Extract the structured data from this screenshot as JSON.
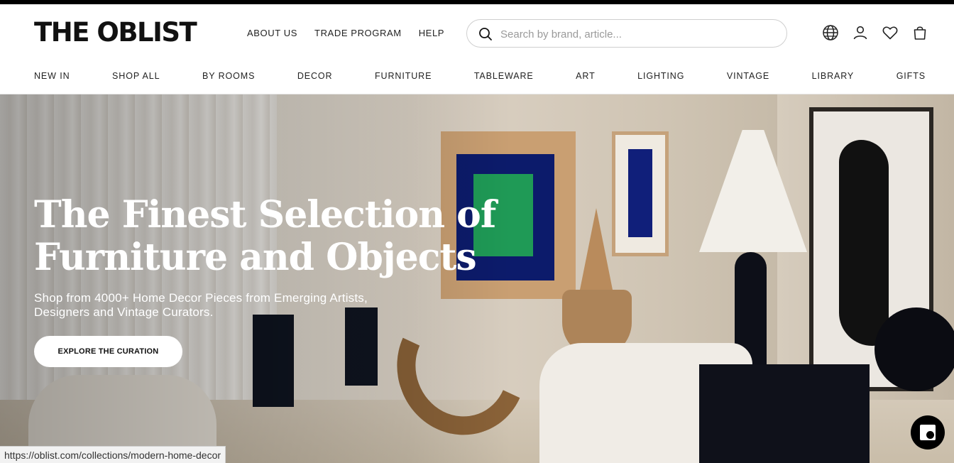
{
  "brand": {
    "logo_text": "THE OBLIST"
  },
  "utility_nav": [
    {
      "label": "ABOUT US"
    },
    {
      "label": "TRADE PROGRAM"
    },
    {
      "label": "HELP"
    }
  ],
  "search": {
    "placeholder": "Search by brand, article...",
    "value": "",
    "icon": "search-icon"
  },
  "header_icons": [
    {
      "name": "globe-icon"
    },
    {
      "name": "account-icon"
    },
    {
      "name": "wishlist-heart-icon"
    },
    {
      "name": "shopping-bag-icon"
    }
  ],
  "category_nav": [
    {
      "label": "NEW IN"
    },
    {
      "label": "SHOP ALL"
    },
    {
      "label": "BY ROOMS"
    },
    {
      "label": "DECOR"
    },
    {
      "label": "FURNITURE"
    },
    {
      "label": "TABLEWARE"
    },
    {
      "label": "ART"
    },
    {
      "label": "LIGHTING"
    },
    {
      "label": "VINTAGE"
    },
    {
      "label": "LIBRARY"
    },
    {
      "label": "GIFTS"
    }
  ],
  "hero": {
    "title_line1": "The Finest Selection of",
    "title_line2": "Furniture and Objects",
    "subtitle": "Shop from 4000+ Home Decor Pieces from Emerging Artists, Designers and Vintage Curators.",
    "cta_label": "EXPLORE THE CURATION"
  },
  "status_bar": {
    "url": "https://oblist.com/collections/modern-home-decor"
  },
  "chat_widget": {
    "icon": "chat-icon"
  },
  "colors": {
    "top_strip": "#000000",
    "text": "#111111",
    "cta_bg": "#ffffff",
    "hero_text": "#ffffff"
  }
}
